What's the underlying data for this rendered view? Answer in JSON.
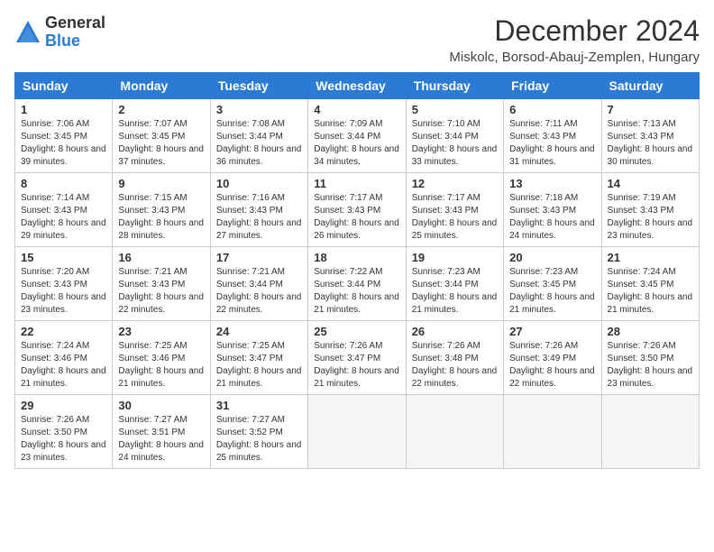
{
  "logo": {
    "general": "General",
    "blue": "Blue"
  },
  "title": "December 2024",
  "location": "Miskolc, Borsod-Abauj-Zemplen, Hungary",
  "headers": [
    "Sunday",
    "Monday",
    "Tuesday",
    "Wednesday",
    "Thursday",
    "Friday",
    "Saturday"
  ],
  "weeks": [
    [
      {
        "day": "1",
        "sunrise": "Sunrise: 7:06 AM",
        "sunset": "Sunset: 3:45 PM",
        "daylight": "Daylight: 8 hours and 39 minutes."
      },
      {
        "day": "2",
        "sunrise": "Sunrise: 7:07 AM",
        "sunset": "Sunset: 3:45 PM",
        "daylight": "Daylight: 8 hours and 37 minutes."
      },
      {
        "day": "3",
        "sunrise": "Sunrise: 7:08 AM",
        "sunset": "Sunset: 3:44 PM",
        "daylight": "Daylight: 8 hours and 36 minutes."
      },
      {
        "day": "4",
        "sunrise": "Sunrise: 7:09 AM",
        "sunset": "Sunset: 3:44 PM",
        "daylight": "Daylight: 8 hours and 34 minutes."
      },
      {
        "day": "5",
        "sunrise": "Sunrise: 7:10 AM",
        "sunset": "Sunset: 3:44 PM",
        "daylight": "Daylight: 8 hours and 33 minutes."
      },
      {
        "day": "6",
        "sunrise": "Sunrise: 7:11 AM",
        "sunset": "Sunset: 3:43 PM",
        "daylight": "Daylight: 8 hours and 31 minutes."
      },
      {
        "day": "7",
        "sunrise": "Sunrise: 7:13 AM",
        "sunset": "Sunset: 3:43 PM",
        "daylight": "Daylight: 8 hours and 30 minutes."
      }
    ],
    [
      {
        "day": "8",
        "sunrise": "Sunrise: 7:14 AM",
        "sunset": "Sunset: 3:43 PM",
        "daylight": "Daylight: 8 hours and 29 minutes."
      },
      {
        "day": "9",
        "sunrise": "Sunrise: 7:15 AM",
        "sunset": "Sunset: 3:43 PM",
        "daylight": "Daylight: 8 hours and 28 minutes."
      },
      {
        "day": "10",
        "sunrise": "Sunrise: 7:16 AM",
        "sunset": "Sunset: 3:43 PM",
        "daylight": "Daylight: 8 hours and 27 minutes."
      },
      {
        "day": "11",
        "sunrise": "Sunrise: 7:17 AM",
        "sunset": "Sunset: 3:43 PM",
        "daylight": "Daylight: 8 hours and 26 minutes."
      },
      {
        "day": "12",
        "sunrise": "Sunrise: 7:17 AM",
        "sunset": "Sunset: 3:43 PM",
        "daylight": "Daylight: 8 hours and 25 minutes."
      },
      {
        "day": "13",
        "sunrise": "Sunrise: 7:18 AM",
        "sunset": "Sunset: 3:43 PM",
        "daylight": "Daylight: 8 hours and 24 minutes."
      },
      {
        "day": "14",
        "sunrise": "Sunrise: 7:19 AM",
        "sunset": "Sunset: 3:43 PM",
        "daylight": "Daylight: 8 hours and 23 minutes."
      }
    ],
    [
      {
        "day": "15",
        "sunrise": "Sunrise: 7:20 AM",
        "sunset": "Sunset: 3:43 PM",
        "daylight": "Daylight: 8 hours and 23 minutes."
      },
      {
        "day": "16",
        "sunrise": "Sunrise: 7:21 AM",
        "sunset": "Sunset: 3:43 PM",
        "daylight": "Daylight: 8 hours and 22 minutes."
      },
      {
        "day": "17",
        "sunrise": "Sunrise: 7:21 AM",
        "sunset": "Sunset: 3:44 PM",
        "daylight": "Daylight: 8 hours and 22 minutes."
      },
      {
        "day": "18",
        "sunrise": "Sunrise: 7:22 AM",
        "sunset": "Sunset: 3:44 PM",
        "daylight": "Daylight: 8 hours and 21 minutes."
      },
      {
        "day": "19",
        "sunrise": "Sunrise: 7:23 AM",
        "sunset": "Sunset: 3:44 PM",
        "daylight": "Daylight: 8 hours and 21 minutes."
      },
      {
        "day": "20",
        "sunrise": "Sunrise: 7:23 AM",
        "sunset": "Sunset: 3:45 PM",
        "daylight": "Daylight: 8 hours and 21 minutes."
      },
      {
        "day": "21",
        "sunrise": "Sunrise: 7:24 AM",
        "sunset": "Sunset: 3:45 PM",
        "daylight": "Daylight: 8 hours and 21 minutes."
      }
    ],
    [
      {
        "day": "22",
        "sunrise": "Sunrise: 7:24 AM",
        "sunset": "Sunset: 3:46 PM",
        "daylight": "Daylight: 8 hours and 21 minutes."
      },
      {
        "day": "23",
        "sunrise": "Sunrise: 7:25 AM",
        "sunset": "Sunset: 3:46 PM",
        "daylight": "Daylight: 8 hours and 21 minutes."
      },
      {
        "day": "24",
        "sunrise": "Sunrise: 7:25 AM",
        "sunset": "Sunset: 3:47 PM",
        "daylight": "Daylight: 8 hours and 21 minutes."
      },
      {
        "day": "25",
        "sunrise": "Sunrise: 7:26 AM",
        "sunset": "Sunset: 3:47 PM",
        "daylight": "Daylight: 8 hours and 21 minutes."
      },
      {
        "day": "26",
        "sunrise": "Sunrise: 7:26 AM",
        "sunset": "Sunset: 3:48 PM",
        "daylight": "Daylight: 8 hours and 22 minutes."
      },
      {
        "day": "27",
        "sunrise": "Sunrise: 7:26 AM",
        "sunset": "Sunset: 3:49 PM",
        "daylight": "Daylight: 8 hours and 22 minutes."
      },
      {
        "day": "28",
        "sunrise": "Sunrise: 7:26 AM",
        "sunset": "Sunset: 3:50 PM",
        "daylight": "Daylight: 8 hours and 23 minutes."
      }
    ],
    [
      {
        "day": "29",
        "sunrise": "Sunrise: 7:26 AM",
        "sunset": "Sunset: 3:50 PM",
        "daylight": "Daylight: 8 hours and 23 minutes."
      },
      {
        "day": "30",
        "sunrise": "Sunrise: 7:27 AM",
        "sunset": "Sunset: 3:51 PM",
        "daylight": "Daylight: 8 hours and 24 minutes."
      },
      {
        "day": "31",
        "sunrise": "Sunrise: 7:27 AM",
        "sunset": "Sunset: 3:52 PM",
        "daylight": "Daylight: 8 hours and 25 minutes."
      },
      null,
      null,
      null,
      null
    ]
  ]
}
